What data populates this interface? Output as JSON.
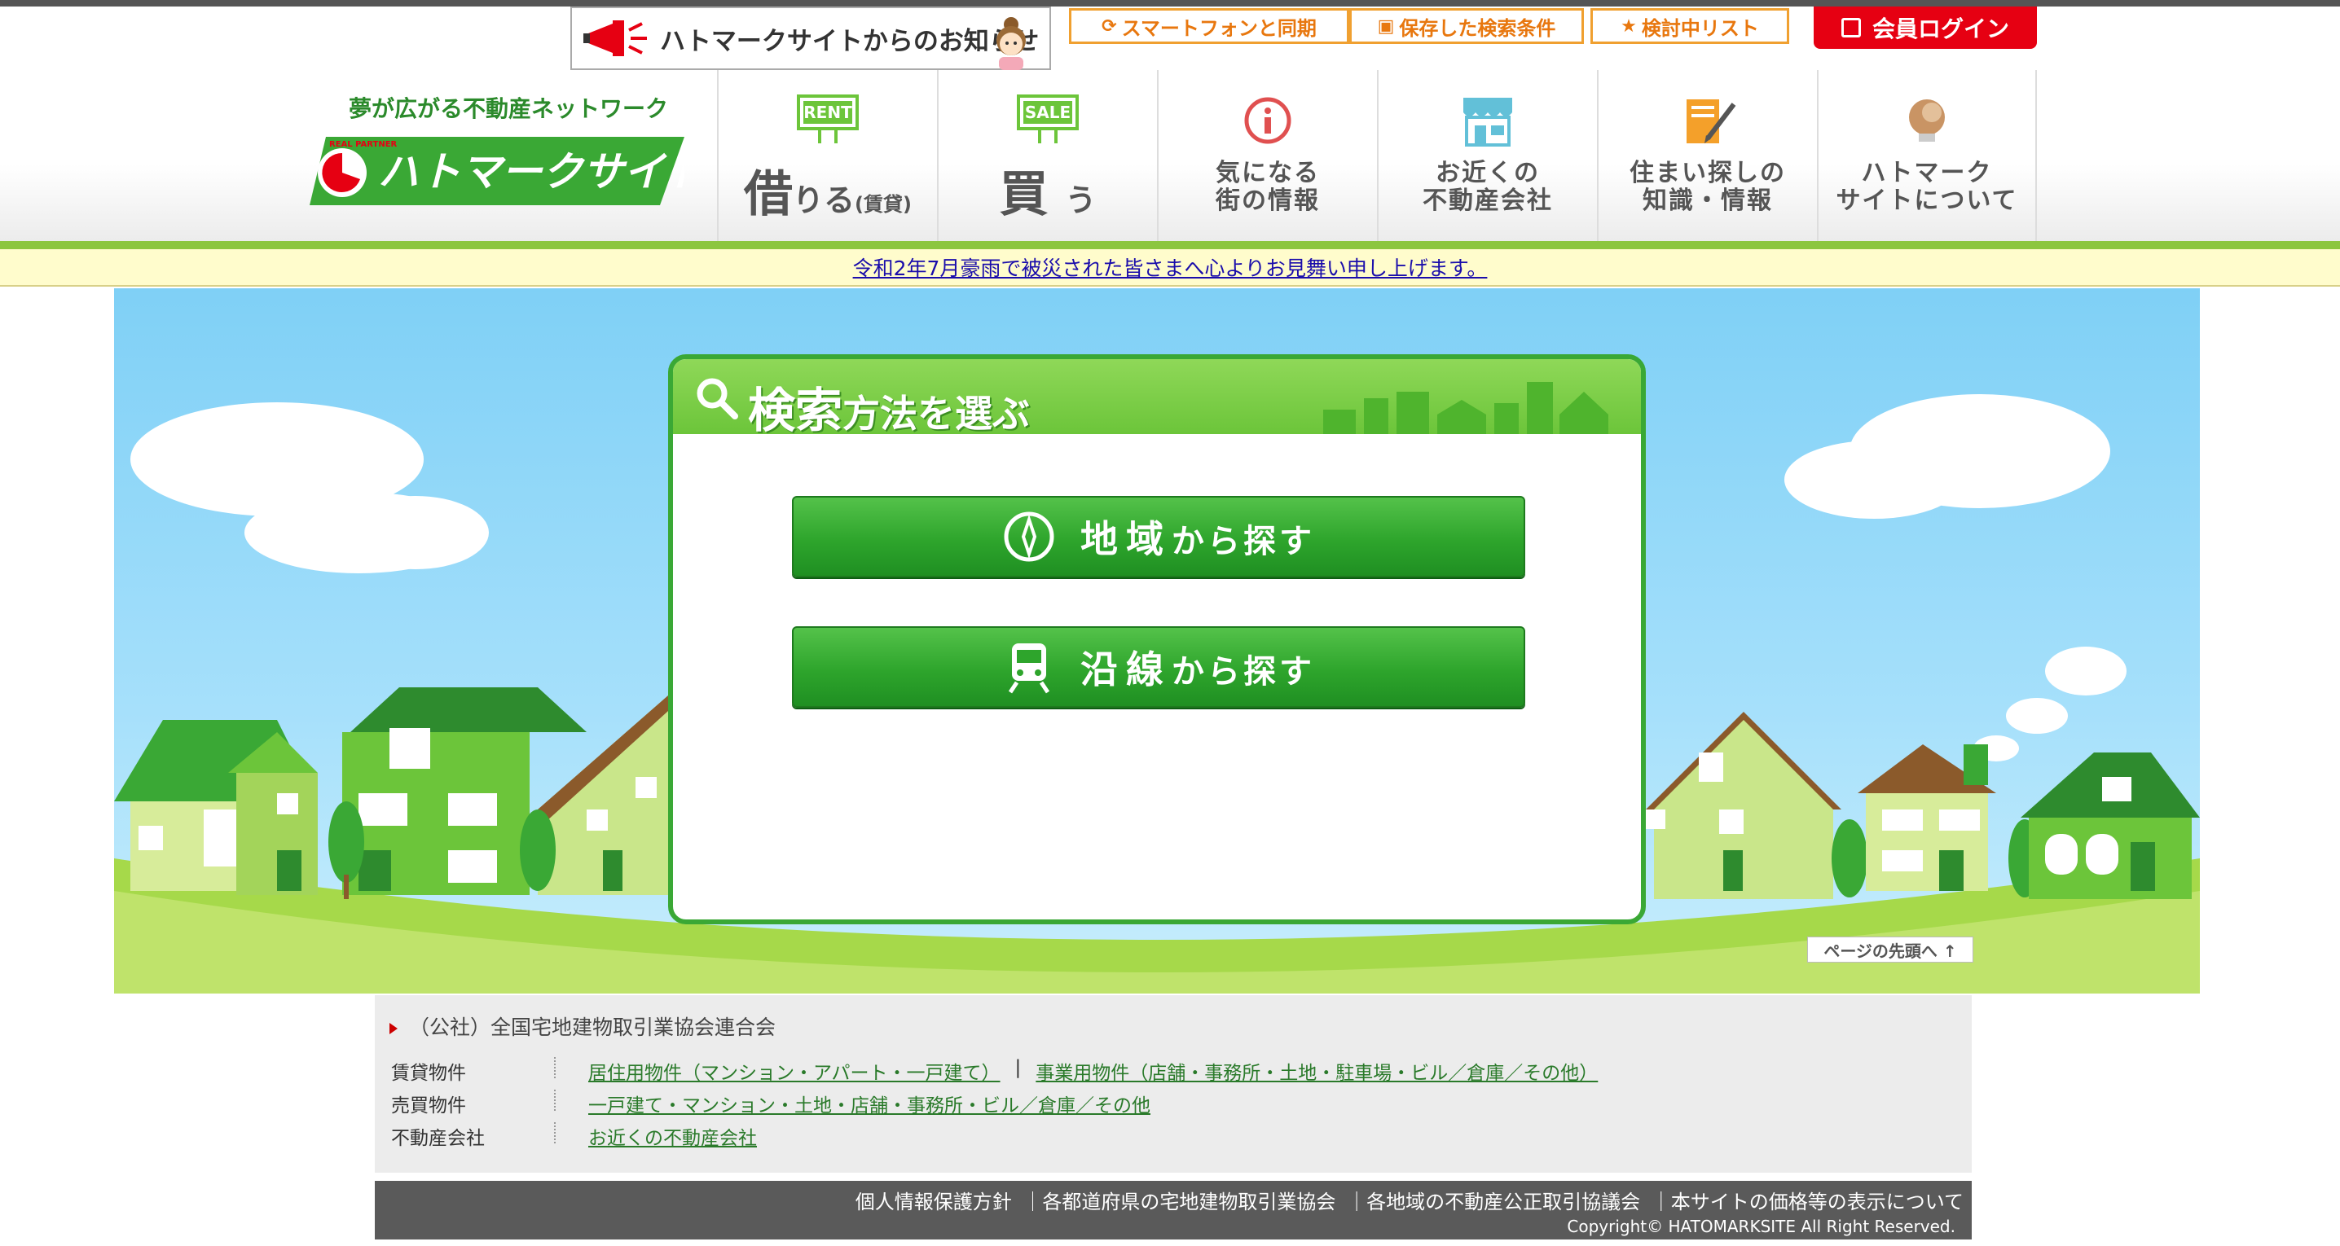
{
  "header": {
    "notice_banner": "ハトマークサイトからのお知らせ",
    "smartphone_sync": "スマートフォンと同期",
    "saved_search": "保存した検索条件",
    "review_list": "検討中リスト",
    "login": "会員ログイン",
    "tagline": "夢が広がる不動産ネットワーク",
    "logo_text": "ハトマークサイト",
    "logo_small": "REAL PARTNER"
  },
  "nav": {
    "rent_badge": "RENT",
    "rent_main": "借",
    "rent_rest": "りる",
    "rent_sub": "(賃貸)",
    "sale_badge": "SALE",
    "sale_main": "買",
    "sale_rest": "う",
    "town_info": "気になる\n街の情報",
    "nearby_agents": "お近くの\n不動産会社",
    "knowledge": "住まい探しの\n知識・情報",
    "about": "ハトマーク\nサイトについて"
  },
  "announcement": "令和2年7月豪雨で被災された皆さまへ心よりお見舞い申し上げます。",
  "search_panel": {
    "title_big": "検索",
    "title_rest": "方法を選ぶ",
    "area_main": "地域",
    "area_rest": "から探す",
    "line_main": "沿線",
    "line_rest": "から探す"
  },
  "page_top": "ページの先頭へ ↑",
  "footer": {
    "org": "（公社）全国宅地建物取引業協会連合会",
    "rows": [
      {
        "label": "賃貸物件",
        "link1": "居住用物件（マンション・アパート・一戸建て）",
        "link2": "事業用物件（店舗・事務所・土地・駐車場・ビル／倉庫／その他）"
      },
      {
        "label": "売買物件",
        "link1": "一戸建て・マンション・土地・店舗・事務所・ビル／倉庫／その他"
      },
      {
        "label": "不動産会社",
        "link1": "お近くの不動産会社"
      }
    ],
    "bottom_links": [
      "個人情報保護方針",
      "｜各都道府県の宅地建物取引業協会",
      "｜各地域の不動産公正取引協議会",
      "｜本サイトの価格等の表示について"
    ],
    "copyright": "Copyright© HATOMARKSITE All Right Reserved."
  },
  "colors": {
    "brand_green": "#2ea52c",
    "login_red": "#e60012",
    "header_orange": "#f0a030",
    "sky": "#7fd0f6"
  },
  "icons": [
    "megaphone-icon",
    "sync-icon",
    "save-icon",
    "star-icon",
    "lock-icon",
    "rent-sign-icon",
    "sale-sign-icon",
    "info-icon",
    "shop-icon",
    "note-pencil-icon",
    "bulb-icon",
    "search-icon",
    "compass-icon",
    "train-icon"
  ]
}
